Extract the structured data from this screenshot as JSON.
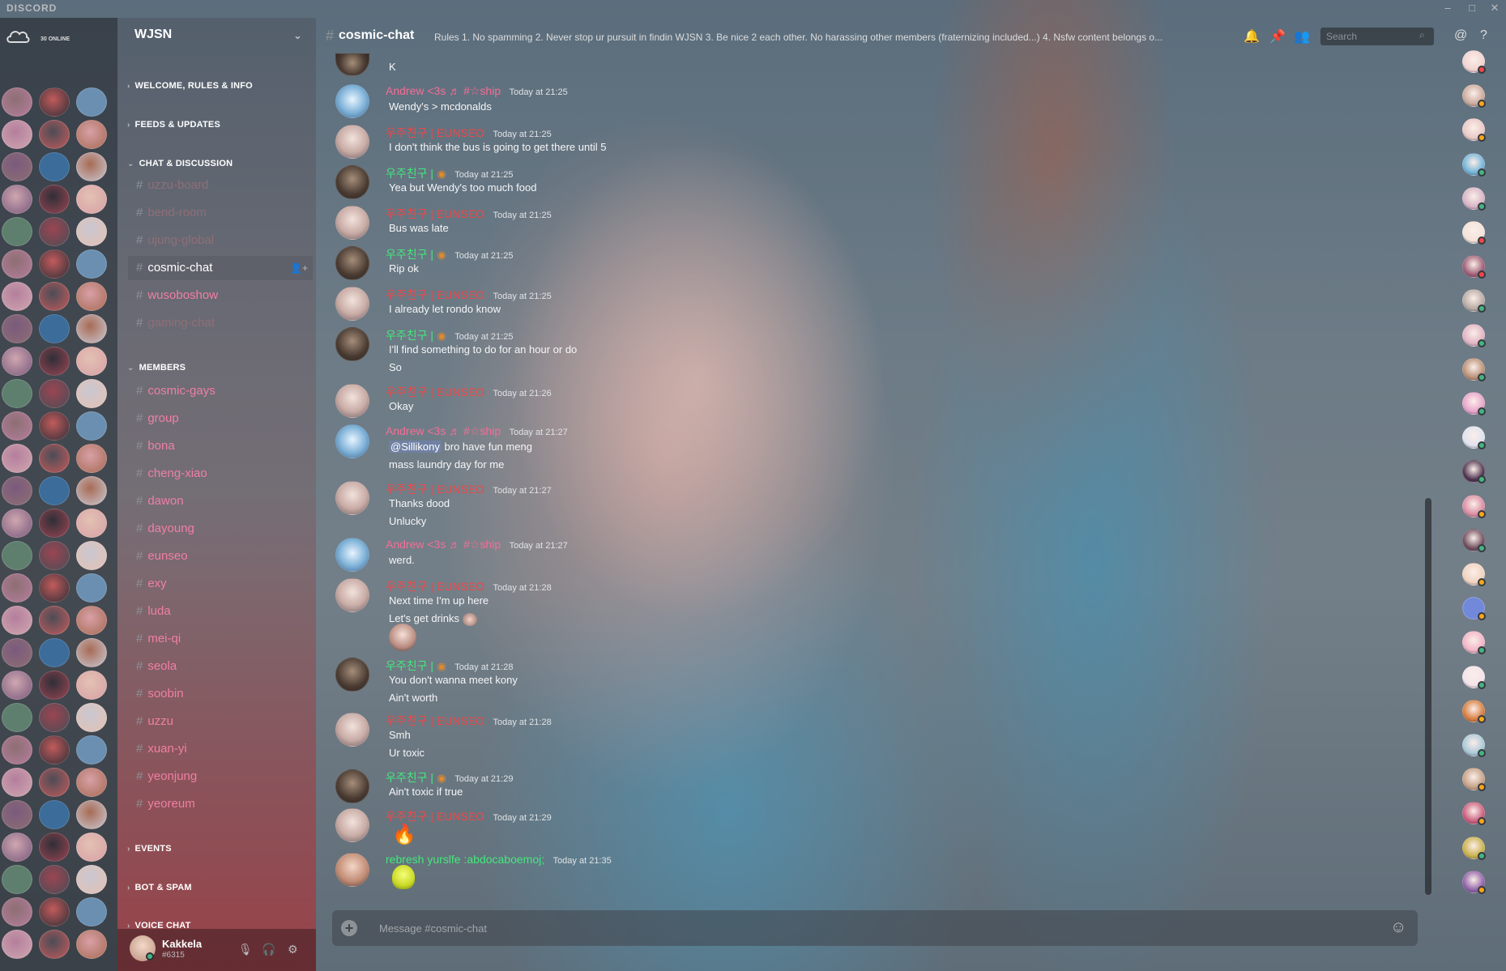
{
  "app": {
    "brand": "DISCORD"
  },
  "window": {
    "minimize": "–",
    "maximize": "□",
    "close": "✕"
  },
  "guild_bar": {
    "online_count": "30 ONLINE"
  },
  "server": {
    "name": "WJSN",
    "categories": {
      "welcome": "WELCOME, RULES & INFO",
      "feeds": "FEEDS & UPDATES",
      "chat": "CHAT & DISCUSSION",
      "members": "MEMBERS",
      "events": "EVENTS",
      "bot": "BOT & SPAM",
      "voice": "VOICE CHAT"
    },
    "chat_channels": [
      "uzzu-board",
      "bend-room",
      "ujung-global",
      "cosmic-chat",
      "wusoboshow",
      "gaming-chat"
    ],
    "member_channels": [
      "cosmic-gays",
      "group",
      "bona",
      "cheng-xiao",
      "dawon",
      "dayoung",
      "eunseo",
      "exy",
      "luda",
      "mei-qi",
      "seola",
      "soobin",
      "uzzu",
      "xuan-yi",
      "yeonjung",
      "yeoreum"
    ]
  },
  "user": {
    "name": "Kakkela",
    "discriminator": "#6315"
  },
  "channel": {
    "name": "cosmic-chat",
    "topic": "Rules 1. No spamming 2. Never stop ur pursuit in findin WJSN 3. Be nice 2 each other. No harassing other members (fraternizing included...) 4. Nsfw content belongs o..."
  },
  "search": {
    "placeholder": "Search"
  },
  "messages": [
    {
      "author": "Andrew <3s ♬ #☆ship",
      "time": "Today at 21:25",
      "lines": [
        "Wendy's > mcdonalds"
      ]
    },
    {
      "author": "우주친구 | EUNSEO",
      "time": "Today at 21:25",
      "lines": [
        "I don't think the bus is going to get there until 5"
      ]
    },
    {
      "author": "우주친구 |",
      "time": "Today at 21:25",
      "lines": [
        "Yea but Wendy's too much food"
      ]
    },
    {
      "author": "우주친구 | EUNSEO",
      "time": "Today at 21:25",
      "lines": [
        "Bus was late"
      ]
    },
    {
      "author": "우주친구 |",
      "time": "Today at 21:25",
      "lines": [
        "Rip ok"
      ]
    },
    {
      "author": "우주친구 | EUNSEO",
      "time": "Today at 21:25",
      "lines": [
        "I already let rondo know"
      ]
    },
    {
      "author": "우주친구 |",
      "time": "Today at 21:25",
      "lines": [
        "I'll find something to do for an hour or do",
        "So"
      ]
    },
    {
      "author": "우주친구 | EUNSEO",
      "time": "Today at 21:26",
      "lines": [
        "Okay"
      ]
    },
    {
      "author": "Andrew <3s ♬ #☆ship",
      "time": "Today at 21:27",
      "mention": "@Sillikony",
      "lines": [
        "bro have fun meng",
        "mass laundry day for me"
      ]
    },
    {
      "author": "우주친구 | EUNSEO",
      "time": "Today at 21:27",
      "lines": [
        "Thanks dood",
        "Unlucky"
      ]
    },
    {
      "author": "Andrew <3s ♬ #☆ship",
      "time": "Today at 21:27",
      "lines": [
        "werd."
      ]
    },
    {
      "author": "우주친구 | EUNSEO",
      "time": "Today at 21:28",
      "lines": [
        "Next time I'm up here",
        "Let's get drinks"
      ]
    },
    {
      "author": "우주친구 |",
      "time": "Today at 21:28",
      "lines": [
        "You don't wanna meet kony",
        "Ain't worth"
      ]
    },
    {
      "author": "우주친구 | EUNSEO",
      "time": "Today at 21:28",
      "lines": [
        "Smh",
        "Ur toxic"
      ]
    },
    {
      "author": "우주친구 |",
      "time": "Today at 21:29",
      "lines": [
        "Ain't toxic if true"
      ]
    },
    {
      "author": "우주친구 | EUNSEO",
      "time": "Today at 21:29",
      "lines": []
    },
    {
      "author": "rebresh yurslfe :abdocaboemoj;",
      "time": "Today at 21:35",
      "lines": []
    }
  ],
  "first_line": "K",
  "composer": {
    "placeholder": "Message #cosmic-chat"
  },
  "colors": {
    "accent": "#7289da",
    "author_blue": "#6fc3f0",
    "author_red": "#f04747",
    "author_green": "#43e97b",
    "channel_pink": "#f07fa4",
    "status_online": "#43b581",
    "status_idle": "#faa61a",
    "status_dnd": "#f04747"
  }
}
